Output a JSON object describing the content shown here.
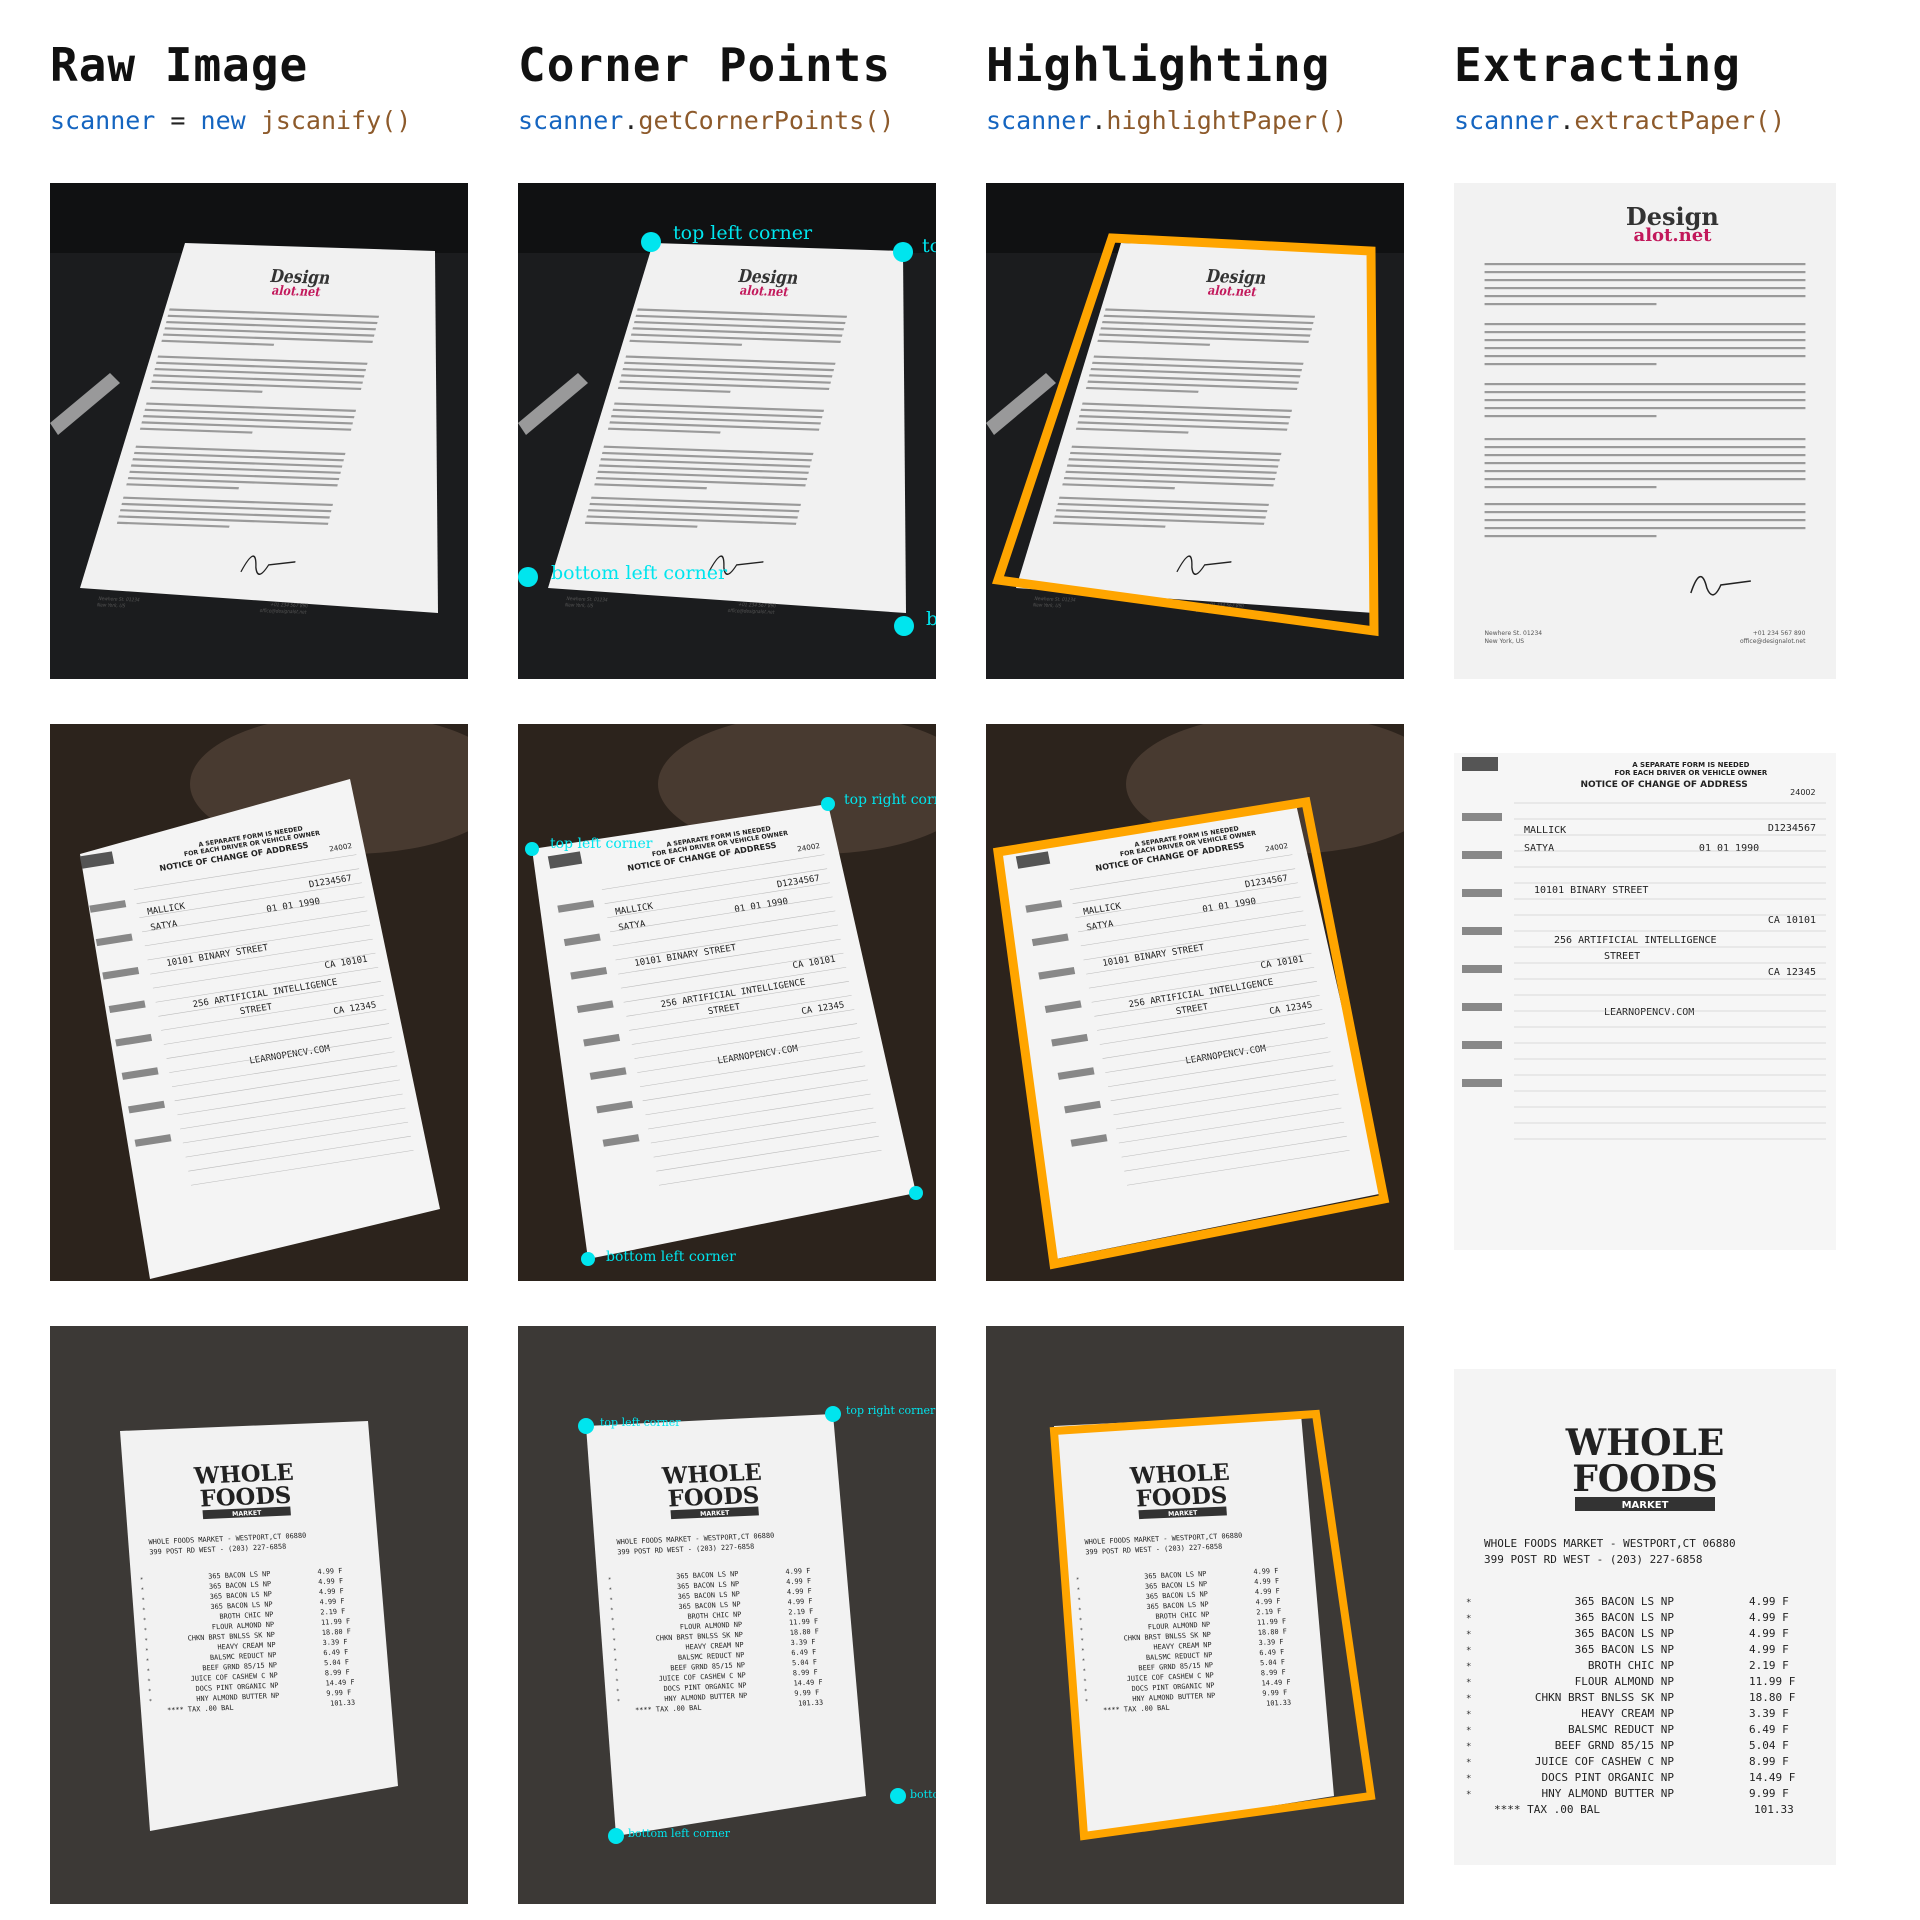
{
  "columns": [
    {
      "title": "Raw Image",
      "code": {
        "object": "scanner",
        "op": " = ",
        "keyword": "new ",
        "func": "jscanify()"
      }
    },
    {
      "title": "Corner Points",
      "code": {
        "object": "scanner",
        "op": ".",
        "keyword": "",
        "func": "getCornerPoints()"
      }
    },
    {
      "title": "Highlighting",
      "code": {
        "object": "scanner",
        "op": ".",
        "keyword": "",
        "func": "highlightPaper()"
      }
    },
    {
      "title": "Extracting",
      "code": {
        "object": "scanner",
        "op": ".",
        "keyword": "",
        "func": "extractPaper()"
      }
    }
  ],
  "corner_labels": {
    "top_left": "top left corner",
    "top_right": "top right corner",
    "bottom_left": "bottom left corner",
    "row1_top_right_clip": "to",
    "row1_bottom_right_clip": "b",
    "row3_bottom_right_clip": "botto"
  },
  "colors": {
    "corner_marker": "#00e5ee",
    "highlight_border": "#ffa500",
    "code_object": "#1565c0",
    "code_function": "#8d5a2b"
  },
  "document_letter": {
    "logo_line1": "Design",
    "logo_line2": "alot.net",
    "address_line1": "Newhere St. 01234",
    "address_line2": "New York, US",
    "phone": "+01 234 567 890",
    "email": "office@designalot.net"
  },
  "document_form": {
    "header1": "A SEPARATE FORM IS NEEDED",
    "header2": "FOR EACH DRIVER OR VEHICLE OWNER",
    "title": "NOTICE OF CHANGE OF ADDRESS",
    "form_number": "24002",
    "line1_left": "MALLICK",
    "line1_right": "D1234567",
    "line2_left": "SATYA",
    "line2_right": "01 01 1990",
    "line3": "10101 BINARY STREET",
    "line3_right": "CA 10101",
    "line4": "256 ARTIFICIAL INTELLIGENCE",
    "line5": "STREET",
    "line5_right": "CA 12345",
    "line6": "LEARNOPENCV.COM"
  },
  "document_receipt": {
    "logo_line1": "WHOLE",
    "logo_line2": "FOODS",
    "logo_line3": "MARKET",
    "store_line1": "WHOLE FOODS MARKET - WESTPORT,CT 06880",
    "store_line2": "399 POST RD WEST - (203) 227-6858",
    "items": [
      {
        "desc": "365   BACON LS NP",
        "price": "4.99 F"
      },
      {
        "desc": "365   BACON LS NP",
        "price": "4.99 F"
      },
      {
        "desc": "365   BACON LS NP",
        "price": "4.99 F"
      },
      {
        "desc": "365   BACON LS NP",
        "price": "4.99 F"
      },
      {
        "desc": "BROTH CHIC NP",
        "price": "2.19 F"
      },
      {
        "desc": "FLOUR ALMOND NP",
        "price": "11.99 F"
      },
      {
        "desc": "CHKN BRST BNLSS SK NP",
        "price": "18.80 F"
      },
      {
        "desc": "HEAVY CREAM NP",
        "price": "3.39 F"
      },
      {
        "desc": "BALSMC REDUCT NP",
        "price": "6.49 F"
      },
      {
        "desc": "BEEF  GRND  85/15 NP",
        "price": "5.04 F"
      },
      {
        "desc": "JUICE COF CASHEW C NP",
        "price": "8.99 F"
      },
      {
        "desc": "DOCS PINT ORGANIC NP",
        "price": "14.49 F"
      },
      {
        "desc": "HNY ALMOND BUTTER NP",
        "price": "9.99 F"
      }
    ],
    "tax_line": "**** TAX   .00   BAL",
    "total": "101.33"
  }
}
